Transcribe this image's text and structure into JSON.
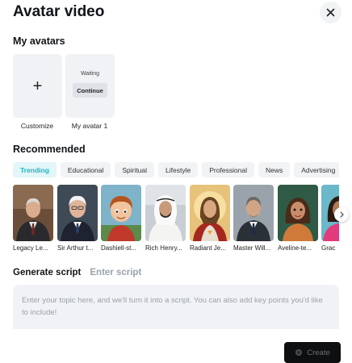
{
  "header": {
    "title": "Avatar video",
    "close_icon": "close-icon"
  },
  "my_avatars": {
    "title": "My avatars",
    "add_card": {
      "icon": "plus-icon",
      "symbol": "+",
      "caption": "Customize"
    },
    "avatar": {
      "status": "Waiting",
      "button_label": "Continue",
      "caption": "My avatar 1"
    }
  },
  "recommended": {
    "title": "Recommended",
    "tabs": [
      "Trending",
      "Educational",
      "Spiritual",
      "Lifestyle",
      "Professional",
      "News",
      "Advertising"
    ],
    "active_tab": "Trending",
    "avatars": [
      {
        "caption": "Legacy Le..."
      },
      {
        "caption": "Sir Arthur t..."
      },
      {
        "caption": "Dashiell-st..."
      },
      {
        "caption": "Rich Henry..."
      },
      {
        "caption": "Radiant Je..."
      },
      {
        "caption": "Master Will..."
      },
      {
        "caption": "Aveline-te..."
      },
      {
        "caption": "Grac"
      }
    ],
    "next_icon": "chevron-right-icon"
  },
  "script": {
    "tabs": [
      "Generate script",
      "Enter script"
    ],
    "active_tab": "Generate script",
    "placeholder": "Enter your topic here, and we'll turn it into a script. You can also add key points you'd like to include!",
    "value": ""
  },
  "create_button": {
    "label": "Create",
    "icon": "spinner-icon"
  },
  "colors": {
    "accent": "#1eb6c6",
    "accent_bg": "#e3f6f9",
    "card_bg": "#f0f2f5",
    "button_dark": "#0e0f11"
  }
}
